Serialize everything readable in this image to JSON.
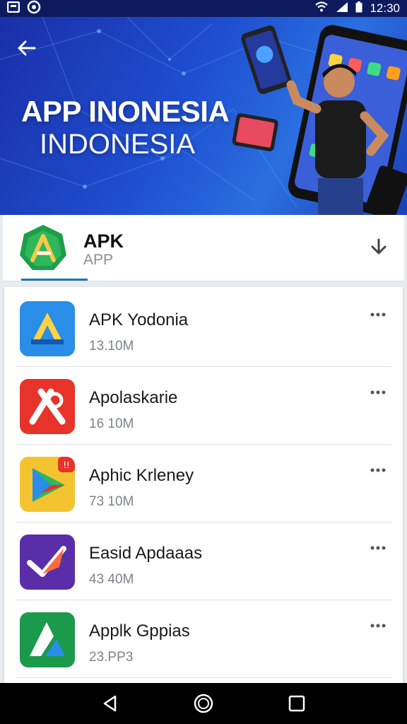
{
  "status_bar": {
    "time": "12:30",
    "left_icon_1": "notification-icon",
    "left_icon_2": "sync-icon",
    "right_icons": [
      "wifi-icon",
      "signal-icon",
      "battery-icon"
    ]
  },
  "hero": {
    "title": "APP INONESIA",
    "subtitle": "INDONESIA",
    "back_icon": "back-arrow-icon",
    "gradient_colors": [
      "#1a2fa8",
      "#2a6fe0"
    ]
  },
  "app_header": {
    "name": "APK",
    "type": "APP",
    "logo_color": "#1e9e4a",
    "download_icon": "download-icon",
    "accent": "#1d7aa8"
  },
  "apps": [
    {
      "name": "APK Yodonia",
      "size": "13.10M",
      "icon": "apk-a-icon",
      "color": "#2a8de8"
    },
    {
      "name": "Apolaskarie",
      "size": "16 10M",
      "icon": "red-app-icon",
      "color": "#e8332a"
    },
    {
      "name": "Aphic Krleney",
      "size": "73 10M",
      "icon": "play-app-icon",
      "color": "#f4c430"
    },
    {
      "name": "Easid Apdaaas",
      "size": "43 40M",
      "icon": "purple-app-icon",
      "color": "#5a2ea8"
    },
    {
      "name": "Applk Gppias",
      "size": "23.PP3",
      "icon": "green-app-icon",
      "color": "#1c9a4c"
    }
  ],
  "nav_bar": {
    "back": "nav-back-icon",
    "home": "nav-home-icon",
    "recents": "nav-recents-icon"
  }
}
